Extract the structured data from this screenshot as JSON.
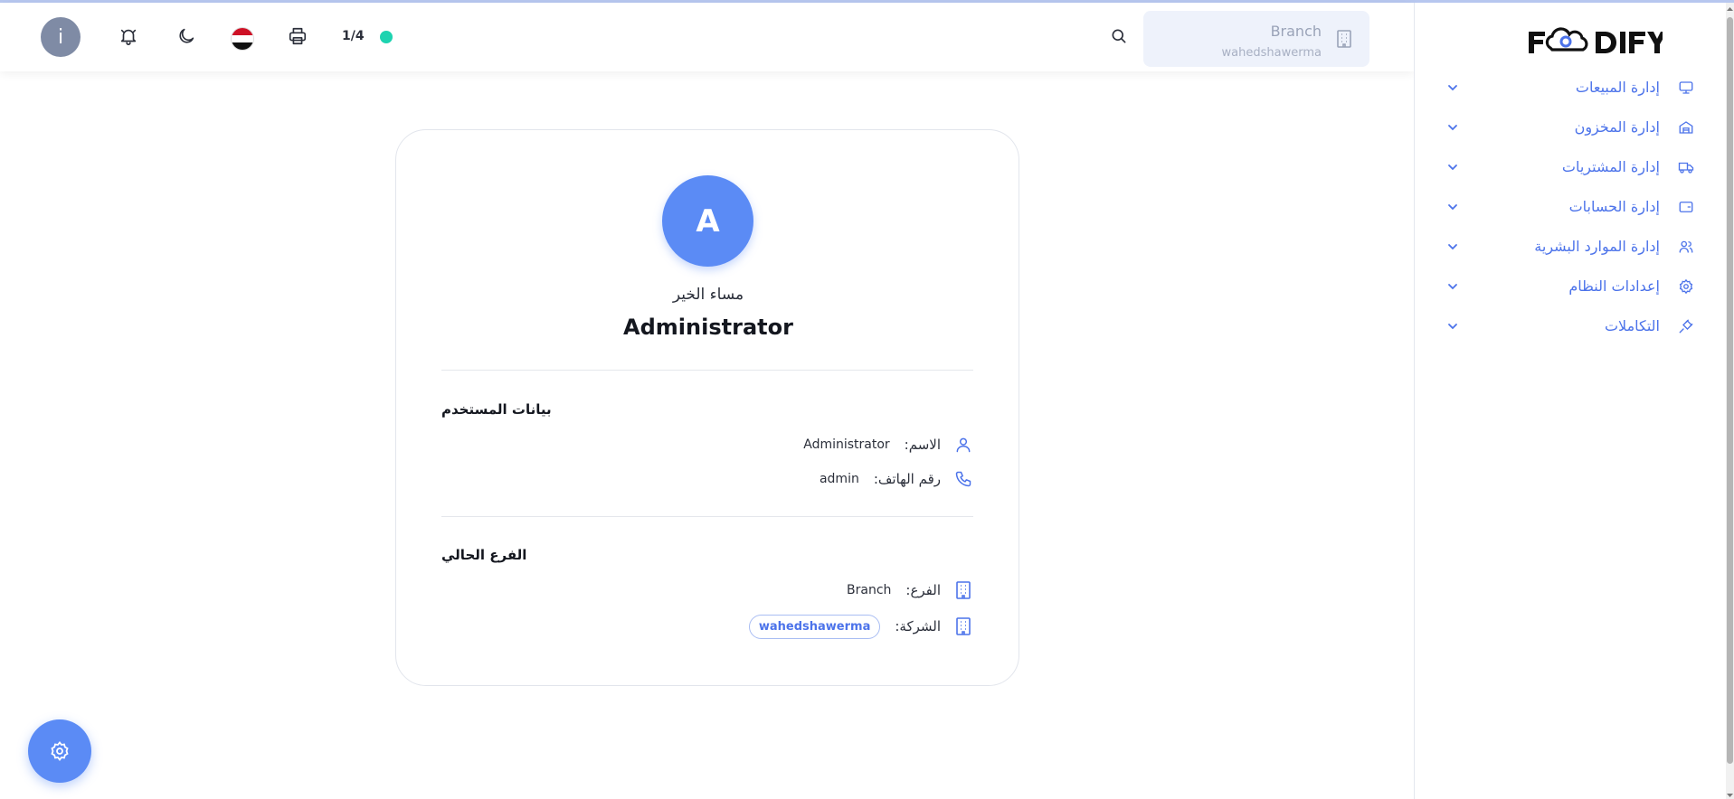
{
  "header": {
    "user_initial": "i",
    "page_indicator": "1/4",
    "branch": {
      "name": "Branch",
      "company": "wahedshawerma"
    },
    "icons": [
      "user-avatar",
      "bell-icon",
      "moon-icon",
      "egypt-flag-icon",
      "printer-icon",
      "search-icon",
      "building-icon"
    ]
  },
  "sidebar": {
    "logo_text": "FOODIFY",
    "items": [
      {
        "label": "إدارة المبيعات",
        "icon": "monitor-icon"
      },
      {
        "label": "إدارة المخزون",
        "icon": "warehouse-icon"
      },
      {
        "label": "إدارة المشتريات",
        "icon": "truck-icon"
      },
      {
        "label": "إدارة الحسابات",
        "icon": "wallet-icon"
      },
      {
        "label": "إدارة الموارد البشرية",
        "icon": "users-icon"
      },
      {
        "label": "إعدادات النظام",
        "icon": "gear-icon"
      },
      {
        "label": "التكاملات",
        "icon": "plug-icon"
      }
    ]
  },
  "profile": {
    "avatar_initial": "A",
    "greeting": "مساء الخير",
    "display_name": "Administrator",
    "user_section": {
      "title": "بيانات المستخدم",
      "name_label": "الاسم:",
      "name_value": "Administrator",
      "phone_label": "رقم الهاتف:",
      "phone_value": "admin"
    },
    "branch_section": {
      "title": "الفرع الحالي",
      "branch_label": "الفرع:",
      "branch_value": "Branch",
      "company_label": "الشركة:",
      "company_value": "wahedshawerma"
    }
  },
  "colors": {
    "accent": "#5b8bf5",
    "nav_text": "#4c73ea",
    "status_online": "#1dd3b0",
    "user_avatar_bg": "#7f8ba5"
  }
}
